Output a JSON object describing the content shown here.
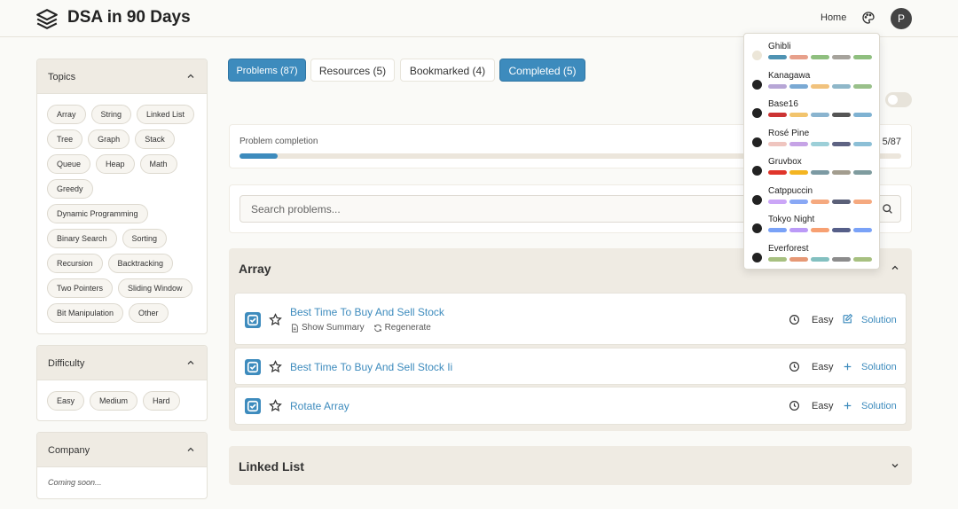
{
  "header": {
    "title": "DSA in 90 Days",
    "home": "Home",
    "avatar": "P"
  },
  "sidebar": {
    "topics": {
      "title": "Topics",
      "tags": [
        "Array",
        "String",
        "Linked List",
        "Tree",
        "Graph",
        "Stack",
        "Queue",
        "Heap",
        "Math",
        "Greedy",
        "Dynamic Programming",
        "Binary Search",
        "Sorting",
        "Recursion",
        "Backtracking",
        "Two Pointers",
        "Sliding Window",
        "Bit Manipulation",
        "Other"
      ]
    },
    "difficulty": {
      "title": "Difficulty",
      "tags": [
        "Easy",
        "Medium",
        "Hard"
      ]
    },
    "company": {
      "title": "Company",
      "note": "Coming soon..."
    }
  },
  "tabs": [
    "Problems (87)",
    "Resources (5)",
    "Bookmarked (4)",
    "Completed (5)"
  ],
  "progress": {
    "label": "Problem completion",
    "count": "5/87",
    "fraction": 0.057
  },
  "search": {
    "placeholder": "Search problems..."
  },
  "sections": [
    {
      "title": "Array",
      "expanded": true
    },
    {
      "title": "Linked List",
      "expanded": false
    }
  ],
  "problems": [
    {
      "title": "Best Time To Buy And Sell Stock",
      "difficulty": "Easy",
      "solution": "Solution",
      "show_summary": "Show Summary",
      "regenerate": "Regenerate",
      "icon": "edit-icon"
    },
    {
      "title": "Best Time To Buy And Sell Stock Ii",
      "difficulty": "Easy",
      "solution": "Solution",
      "icon": "plus-icon"
    },
    {
      "title": "Rotate Array",
      "difficulty": "Easy",
      "solution": "Solution",
      "icon": "plus-icon"
    }
  ],
  "themes": [
    {
      "name": "Ghibli",
      "colors": [
        "#4f93b3",
        "#e7a08b",
        "#8fbf7f",
        "#a6a39c",
        "#8fbf7f"
      ]
    },
    {
      "name": "Kanagawa",
      "colors": [
        "#b7a6d6",
        "#7aa9d4",
        "#f1c27d",
        "#8fb7c9",
        "#99c08a"
      ]
    },
    {
      "name": "Base16",
      "colors": [
        "#cc3333",
        "#f2c46d",
        "#8ab4cf",
        "#555555",
        "#7fb2d2"
      ]
    },
    {
      "name": "Rosé Pine",
      "colors": [
        "#efc5bf",
        "#c6a3e6",
        "#9ccfd8",
        "#5e6383",
        "#8cbfd6"
      ]
    },
    {
      "name": "Gruvbox",
      "colors": [
        "#e0352b",
        "#f4b522",
        "#7c9aa3",
        "#a39d8f",
        "#7f9c9f"
      ]
    },
    {
      "name": "Catppuccin",
      "colors": [
        "#cba6f7",
        "#89a8f5",
        "#f5a97f",
        "#5b6078",
        "#f5a97f"
      ]
    },
    {
      "name": "Tokyo Night",
      "colors": [
        "#7aa2f7",
        "#bb9af7",
        "#f7a072",
        "#565f89",
        "#7aa2f7"
      ]
    },
    {
      "name": "Everforest",
      "colors": [
        "#a7c080",
        "#e69875",
        "#83c0c0",
        "#8c8c8c",
        "#a7c080"
      ]
    }
  ]
}
